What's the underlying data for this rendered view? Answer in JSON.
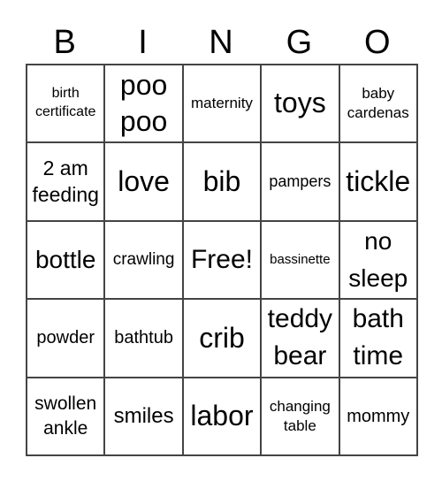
{
  "header": [
    "B",
    "I",
    "N",
    "G",
    "O"
  ],
  "cells": [
    "birth certificate",
    "poo poo",
    "maternity",
    "toys",
    "baby cardenas",
    "2 am feeding",
    "love",
    "bib",
    "pampers",
    "tickle",
    "bottle",
    "crawling",
    "Free!",
    "bassinette",
    "no sleep",
    "powder",
    "bathtub",
    "crib",
    "teddy bear",
    "bath time",
    "swollen ankle",
    "smiles",
    "labor",
    "changing table",
    "mommy"
  ]
}
